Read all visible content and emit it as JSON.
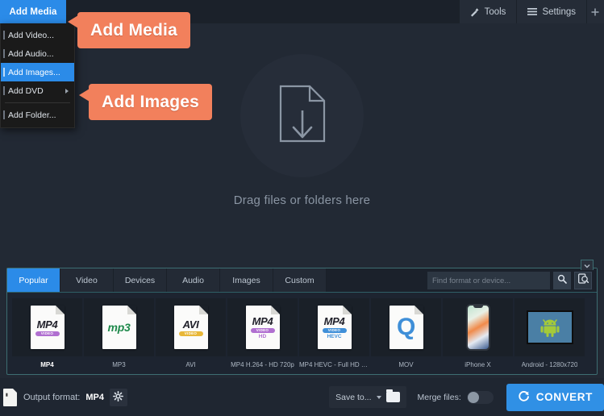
{
  "topbar": {
    "add_media_tab": "Add Media",
    "tools_label": "Tools",
    "settings_label": "Settings",
    "tools_icon": "magic-wand-icon",
    "settings_icon": "hamburger-icon"
  },
  "menu": {
    "items": [
      {
        "label": "Add Video...",
        "active": false,
        "submenu": false
      },
      {
        "label": "Add Audio...",
        "active": false,
        "submenu": false
      },
      {
        "label": "Add Images...",
        "active": true,
        "submenu": false
      },
      {
        "label": "Add DVD",
        "active": false,
        "submenu": true
      },
      {
        "label": "Add Folder...",
        "active": false,
        "submenu": false
      }
    ]
  },
  "callouts": [
    {
      "text": "Add Media"
    },
    {
      "text": "Add Images"
    }
  ],
  "dropzone": {
    "label": "Drag files or folders here",
    "icon": "file-download-icon"
  },
  "format_panel": {
    "tabs": [
      {
        "label": "Popular",
        "active": true
      },
      {
        "label": "Video",
        "active": false
      },
      {
        "label": "Devices",
        "active": false
      },
      {
        "label": "Audio",
        "active": false
      },
      {
        "label": "Images",
        "active": false
      },
      {
        "label": "Custom",
        "active": false
      }
    ],
    "search": {
      "value": "",
      "placeholder": "Find format or device...",
      "go_icon": "search-icon",
      "advanced_icon": "advanced-search-icon"
    },
    "collapse_icon": "chevron-down-icon",
    "tiles": [
      {
        "label": "MP4",
        "kind": "sheet",
        "main": "MP4",
        "bar": "VIDEO",
        "bar_color": "#b06fd0",
        "sub": "",
        "sub_color": "",
        "selected": true
      },
      {
        "label": "MP3",
        "kind": "mp3",
        "main": "mp3",
        "bar": "",
        "bar_color": "",
        "sub": "",
        "sub_color": "",
        "selected": false
      },
      {
        "label": "AVI",
        "kind": "sheet",
        "main": "AVI",
        "bar": "VIDEO",
        "bar_color": "#e8b738",
        "sub": "",
        "sub_color": "",
        "selected": false
      },
      {
        "label": "MP4 H.264 - HD 720p",
        "kind": "sheet",
        "main": "MP4",
        "bar": "VIDEO",
        "bar_color": "#b06fd0",
        "sub": "HD",
        "sub_color": "#b06fd0",
        "selected": false
      },
      {
        "label": "MP4 HEVC - Full HD 1...",
        "kind": "sheet",
        "main": "MP4",
        "bar": "VIDEO",
        "bar_color": "#3f8fd8",
        "sub": "HEVC",
        "sub_color": "#3f8fd8",
        "selected": false
      },
      {
        "label": "MOV",
        "kind": "mov",
        "main": "Q",
        "bar": "",
        "bar_color": "",
        "sub": "",
        "sub_color": "",
        "selected": false
      },
      {
        "label": "iPhone X",
        "kind": "phone",
        "main": "",
        "bar": "",
        "bar_color": "",
        "sub": "",
        "sub_color": "",
        "selected": false
      },
      {
        "label": "Android - 1280x720",
        "kind": "android",
        "main": "",
        "bar": "",
        "bar_color": "",
        "sub": "",
        "sub_color": "",
        "selected": false
      }
    ]
  },
  "bottombar": {
    "output_format_label": "Output format:",
    "output_format_value": "MP4",
    "gear_icon": "gear-icon",
    "save_to_label": "Save to...",
    "folder_icon": "folder-icon",
    "merge_label": "Merge files:",
    "merge_enabled": false,
    "convert_label": "CONVERT",
    "convert_icon": "refresh-icon"
  },
  "colors": {
    "accent_blue": "#2b8be8",
    "callout_orange": "#f2805c",
    "panel_bg": "#1d2430",
    "app_bg": "#222934",
    "panel_border_teal": "#3d6d72",
    "convert_blue": "#3090e5"
  }
}
